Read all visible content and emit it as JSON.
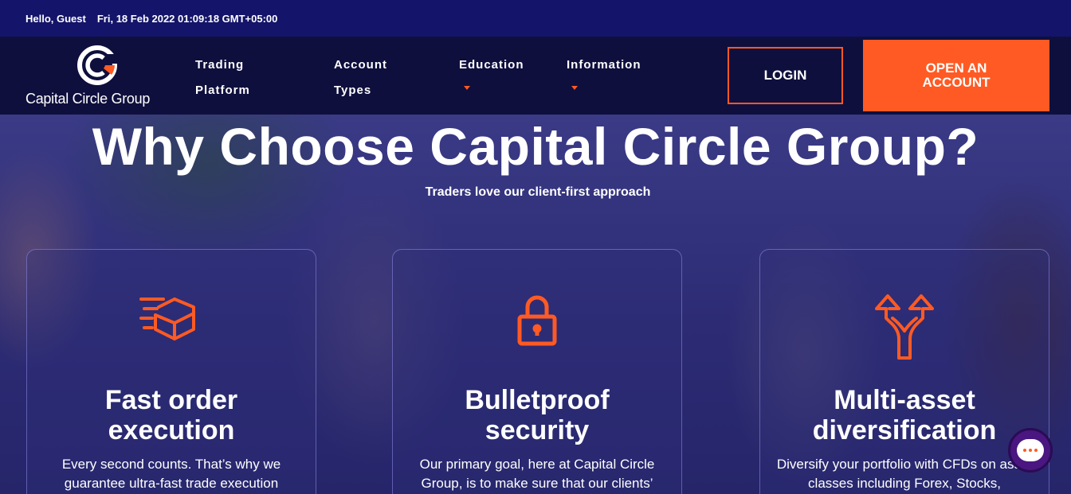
{
  "topbar": {
    "greeting": "Hello, Guest",
    "datetime": "Fri, 18 Feb 2022 01:09:18 GMT+05:00"
  },
  "brand": {
    "name": "Capital Circle Group",
    "accent": "#ff5a23"
  },
  "nav": {
    "items": [
      {
        "label": "Trading Platform",
        "has_dropdown": false
      },
      {
        "label": "Account Types",
        "has_dropdown": false
      },
      {
        "label": "Education",
        "has_dropdown": true
      },
      {
        "label": "Information",
        "has_dropdown": true
      }
    ],
    "login_label": "LOGIN",
    "open_account_label": "OPEN AN ACCOUNT"
  },
  "hero": {
    "title": "Why Choose Capital Circle Group?",
    "subtitle": "Traders love our client-first approach"
  },
  "cards": [
    {
      "icon": "fast-delivery-box-icon",
      "title": "Fast order execution",
      "text": "Every second counts. That’s why we guarantee ultra-fast trade execution"
    },
    {
      "icon": "lock-icon",
      "title": "Bulletproof security",
      "text": "Our primary goal, here at Capital Circle Group, is to make sure that our clients’"
    },
    {
      "icon": "split-arrows-icon",
      "title": "Multi-asset diversification",
      "text": "Diversify your portfolio with CFDs on asset classes including Forex, Stocks,"
    }
  ],
  "chat": {
    "icon": "chat-bubble-icon"
  }
}
